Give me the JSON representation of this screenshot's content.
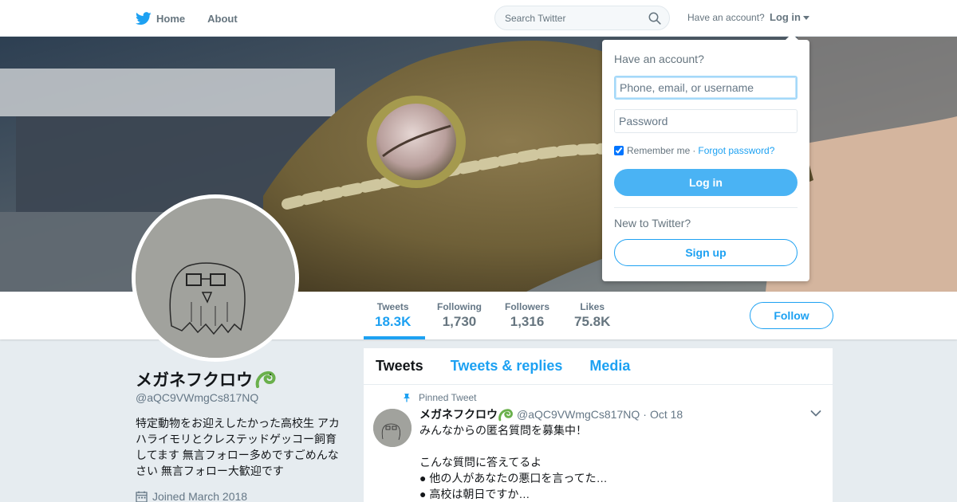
{
  "nav": {
    "home_label": "Home",
    "about_label": "About",
    "search_placeholder": "Search Twitter",
    "account_question": "Have an account?",
    "login_label": "Log in"
  },
  "profile": {
    "name": "メガネフクロウ",
    "handle": "@aQC9VWmgCs817NQ",
    "bio": "特定動物をお迎えしたかった高校生 アカハライモリとクレステッドゲッコー飼育してます 無言フォロー多めですごめんなさい 無言フォロー大歓迎です",
    "joined": "Joined March 2018"
  },
  "stats": [
    {
      "label": "Tweets",
      "value": "18.3K"
    },
    {
      "label": "Following",
      "value": "1,730"
    },
    {
      "label": "Followers",
      "value": "1,316"
    },
    {
      "label": "Likes",
      "value": "75.8K"
    }
  ],
  "follow_label": "Follow",
  "timeline": {
    "tabs": [
      "Tweets",
      "Tweets & replies",
      "Media"
    ],
    "pinned_label": "Pinned Tweet",
    "tweet": {
      "name": "メガネフクロウ",
      "handle": "@aQC9VWmgCs817NQ",
      "separator": "·",
      "date": "Oct 18",
      "lines": [
        "みんなからの匿名質問を募集中！",
        "",
        "こんな質問に答えてるよ",
        "● 他の人があなたの悪口を言ってた…",
        "● 高校は朝日ですか…"
      ]
    }
  },
  "login_dropdown": {
    "question": "Have an account?",
    "username_placeholder": "Phone, email, or username",
    "password_placeholder": "Password",
    "remember_label": "Remember me",
    "separator": "·",
    "forgot_label": "Forgot password?",
    "login_button": "Log in",
    "new_question": "New to Twitter?",
    "signup_button": "Sign up"
  },
  "colors": {
    "accent": "#1da1f2",
    "login_button": "#4ab3f4",
    "background": "#e6ecf0"
  }
}
